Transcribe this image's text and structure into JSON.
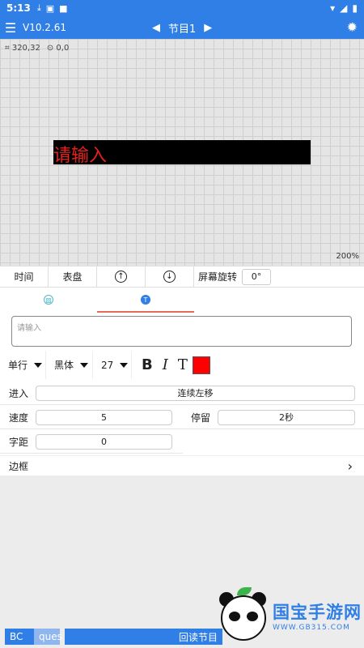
{
  "status": {
    "time": "5:13"
  },
  "header": {
    "version": "V10.2.61",
    "program_title": "节目1"
  },
  "canvas": {
    "coord_size": "320,32",
    "coord_pos": "0,0",
    "led_text": "请输入",
    "zoom": "200%"
  },
  "toolbar": {
    "time_label": "时间",
    "dial_label": "表盘",
    "rotate_label": "屏幕旋转",
    "rotate_value": "0°"
  },
  "editor": {
    "input_placeholder": "请输入"
  },
  "font": {
    "line_mode": "单行",
    "family": "黑体",
    "size": "27",
    "bold": "B",
    "italic": "I",
    "text_t": "T",
    "color": "#ff0000"
  },
  "effects": {
    "enter_label": "进入",
    "enter_value": "连续左移",
    "speed_label": "速度",
    "speed_value": "5",
    "stay_label": "停留",
    "stay_value": "2秒",
    "spacing_label": "字距",
    "spacing_value": "0"
  },
  "border": {
    "label": "边框"
  },
  "bottom": {
    "left_text": "BC",
    "mid_text": "ques",
    "right_text": "回读节目"
  },
  "watermark": {
    "main": "国宝手游网",
    "sub": "WWW.GB315.COM"
  }
}
